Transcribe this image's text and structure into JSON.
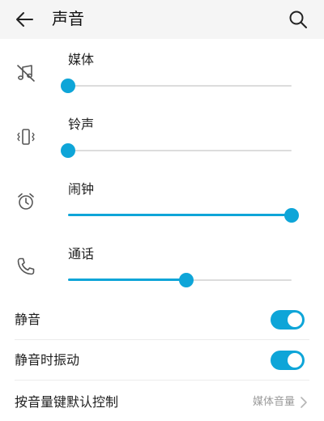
{
  "header": {
    "title": "声音",
    "back_icon": "arrow-left-icon",
    "search_icon": "search-icon"
  },
  "accent_color": "#0ea5d8",
  "volumes": [
    {
      "label": "媒体",
      "icon": "music-muted-icon",
      "level": 0.0
    },
    {
      "label": "铃声",
      "icon": "vibrate-phone-icon",
      "level": 0.0
    },
    {
      "label": "闹钟",
      "icon": "alarm-clock-icon",
      "level": 1.0
    },
    {
      "label": "通话",
      "icon": "phone-icon",
      "level": 0.53
    }
  ],
  "settings": [
    {
      "label": "静音",
      "on": true
    },
    {
      "label": "静音时振动",
      "on": true
    },
    {
      "label": "按音量键默认控制",
      "value": "媒体音量"
    }
  ]
}
